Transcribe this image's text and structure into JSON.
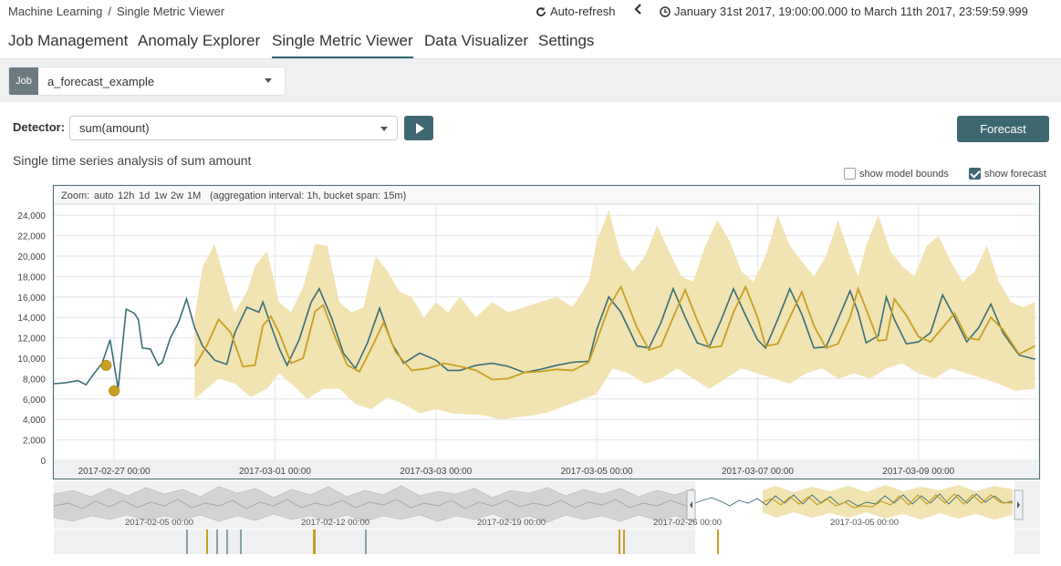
{
  "breadcrumb": {
    "root": "Machine Learning",
    "separator": "/",
    "current": "Single Metric Viewer"
  },
  "header": {
    "auto_refresh": "Auto-refresh",
    "time_range": "January 31st 2017, 19:00:00.000 to March 11th 2017, 23:59:59.999"
  },
  "tabs": [
    {
      "label": "Job Management"
    },
    {
      "label": "Anomaly Explorer"
    },
    {
      "label": "Single Metric Viewer",
      "active": true
    },
    {
      "label": "Data Visualizer"
    },
    {
      "label": "Settings"
    }
  ],
  "job": {
    "badge": "Job",
    "name": "a_forecast_example"
  },
  "detector": {
    "label": "Detector:",
    "value": "sum(amount)"
  },
  "forecast_button": "Forecast",
  "subtitle": "Single time series analysis of sum amount",
  "options": {
    "model_bounds": {
      "label": "show model bounds",
      "checked": false
    },
    "forecast": {
      "label": "show forecast",
      "checked": true
    }
  },
  "zoom": {
    "label": "Zoom:",
    "options": [
      "auto",
      "12h",
      "1d",
      "1w",
      "2w",
      "1M"
    ],
    "info": "(aggregation interval: 1h, bucket span: 15m)"
  },
  "colors": {
    "actual": "#3b6e77",
    "forecast": "#c8a022",
    "bounds": "#f2e3b3",
    "anomaly": "#c8a022",
    "context_grey": "#d4d4d4",
    "tab_underline": "#2d6670",
    "button": "#3e6871"
  },
  "context_ticks": [
    "2017-02-05 00:00",
    "2017-02-12 00:00",
    "2017-02-19 00:00",
    "2017-02-26 00:00",
    "2017-03-05 00:00"
  ],
  "chart_data": {
    "type": "line",
    "title": "",
    "xlabel": "",
    "ylabel": "",
    "ylim": [
      0,
      25000
    ],
    "y_ticks": [
      0,
      2000,
      4000,
      6000,
      8000,
      10000,
      12000,
      14000,
      16000,
      18000,
      20000,
      22000,
      24000
    ],
    "y_tick_labels": [
      "0",
      "2,000",
      "4,000",
      "6,000",
      "8,000",
      "10,000",
      "12,000",
      "14,000",
      "16,000",
      "18,000",
      "20,000",
      "22,000",
      "24,000"
    ],
    "x_tick_labels": [
      "2017-02-27 00:00",
      "2017-03-01 00:00",
      "2017-03-03 00:00",
      "2017-03-05 00:00",
      "2017-03-07 00:00",
      "2017-03-09 00:00"
    ],
    "xlim_days": [
      -0.75,
      11.5
    ],
    "grid": true,
    "series": [
      {
        "kind": "actual",
        "x": [
          -0.75,
          -0.6,
          -0.45,
          -0.35,
          -0.25,
          -0.15,
          -0.05,
          0.05,
          0.15,
          0.25,
          0.3,
          0.35,
          0.45,
          0.55,
          0.6,
          0.7,
          0.8,
          0.9,
          1.0,
          1.1,
          1.25,
          1.4,
          1.5,
          1.65,
          1.8,
          1.85,
          1.95,
          2.05,
          2.15,
          2.3,
          2.45,
          2.55,
          2.7,
          2.85,
          3.0,
          3.15,
          3.3,
          3.45,
          3.6,
          3.8,
          4.0,
          4.15,
          4.3,
          4.5,
          4.7,
          4.9,
          5.1,
          5.3,
          5.5,
          5.7,
          5.9,
          6.0,
          6.15,
          6.3,
          6.5,
          6.65,
          6.8,
          6.95,
          7.1,
          7.25,
          7.4,
          7.55,
          7.7,
          7.85,
          8.0,
          8.1,
          8.25,
          8.4,
          8.55,
          8.7,
          8.85,
          9.0,
          9.15,
          9.25,
          9.35,
          9.5,
          9.6,
          9.7,
          9.85,
          10.0,
          10.15,
          10.3,
          10.45,
          10.6,
          10.75,
          10.9,
          11.05,
          11.25,
          11.45
        ],
        "y": [
          7500,
          7600,
          7800,
          7400,
          8500,
          9500,
          11800,
          7000,
          14800,
          14400,
          13800,
          11000,
          10900,
          9300,
          9600,
          12000,
          13500,
          15800,
          13000,
          11200,
          9800,
          9400,
          12500,
          15000,
          14500,
          15500,
          13200,
          11000,
          9300,
          11800,
          15500,
          16800,
          14000,
          10500,
          9000,
          11500,
          14900,
          11500,
          9500,
          10500,
          9800,
          8800,
          8800,
          9300,
          9500,
          9200,
          8600,
          8900,
          9300,
          9600,
          9700,
          12800,
          16000,
          14500,
          11200,
          11000,
          13500,
          16800,
          14000,
          11500,
          11100,
          13800,
          16800,
          14200,
          11800,
          11000,
          13800,
          16800,
          14300,
          11000,
          11100,
          13800,
          16600,
          14500,
          11500,
          12200,
          16000,
          13800,
          11400,
          11600,
          12500,
          16200,
          14000,
          11600,
          13000,
          15300,
          12500,
          10300,
          9900
        ]
      },
      {
        "kind": "forecast",
        "x": [
          1.0,
          1.15,
          1.3,
          1.45,
          1.6,
          1.75,
          1.85,
          1.95,
          2.05,
          2.2,
          2.35,
          2.5,
          2.6,
          2.75,
          2.9,
          3.05,
          3.2,
          3.35,
          3.5,
          3.7,
          3.9,
          4.1,
          4.3,
          4.5,
          4.7,
          4.9,
          5.1,
          5.3,
          5.5,
          5.7,
          5.9,
          6.0,
          6.15,
          6.3,
          6.5,
          6.65,
          6.8,
          6.95,
          7.1,
          7.25,
          7.4,
          7.55,
          7.7,
          7.85,
          8.0,
          8.1,
          8.25,
          8.4,
          8.55,
          8.7,
          8.85,
          9.0,
          9.15,
          9.25,
          9.35,
          9.5,
          9.6,
          9.7,
          9.85,
          10.0,
          10.15,
          10.3,
          10.45,
          10.6,
          10.75,
          10.9,
          11.05,
          11.25,
          11.45
        ],
        "y": [
          9200,
          11200,
          13800,
          12500,
          9200,
          9300,
          13200,
          14100,
          12500,
          9500,
          10000,
          14600,
          15200,
          12000,
          9300,
          8700,
          11000,
          13500,
          10600,
          8800,
          9000,
          9500,
          9200,
          8800,
          7900,
          8000,
          8600,
          8700,
          8900,
          8800,
          9600,
          11700,
          15000,
          17000,
          13000,
          10800,
          11200,
          14000,
          16700,
          13700,
          11000,
          11200,
          14500,
          17000,
          14000,
          11200,
          11400,
          14000,
          16500,
          13200,
          11000,
          11400,
          14000,
          16800,
          14800,
          11700,
          11800,
          15800,
          14200,
          12100,
          11600,
          13000,
          14400,
          12000,
          11800,
          14000,
          12800,
          10400,
          11200
        ]
      },
      {
        "kind": "bounds_upper",
        "x": [
          1.0,
          1.1,
          1.25,
          1.4,
          1.5,
          1.65,
          1.75,
          1.9,
          2.05,
          2.2,
          2.35,
          2.5,
          2.65,
          2.8,
          2.95,
          3.1,
          3.25,
          3.4,
          3.55,
          3.7,
          3.85,
          4.0,
          4.15,
          4.3,
          4.5,
          4.7,
          4.9,
          5.1,
          5.3,
          5.5,
          5.7,
          5.9,
          6.0,
          6.15,
          6.3,
          6.45,
          6.6,
          6.75,
          6.9,
          7.05,
          7.2,
          7.35,
          7.5,
          7.65,
          7.8,
          7.95,
          8.1,
          8.25,
          8.4,
          8.55,
          8.7,
          8.85,
          9.0,
          9.15,
          9.25,
          9.35,
          9.5,
          9.65,
          9.8,
          9.95,
          10.1,
          10.25,
          10.4,
          10.55,
          10.7,
          10.85,
          11.0,
          11.15,
          11.3,
          11.45
        ],
        "y": [
          14000,
          19000,
          21200,
          17000,
          14500,
          16500,
          19000,
          20500,
          15500,
          14500,
          17000,
          21200,
          21000,
          15500,
          14500,
          15000,
          20000,
          18500,
          16500,
          16000,
          14000,
          15500,
          14500,
          16000,
          14000,
          15500,
          14500,
          15000,
          15500,
          16000,
          15000,
          17500,
          21500,
          24500,
          20000,
          18500,
          20000,
          23000,
          20500,
          18000,
          17500,
          21000,
          23500,
          21500,
          18500,
          17500,
          20000,
          24000,
          21000,
          19500,
          18000,
          20000,
          23500,
          20000,
          18000,
          21000,
          24000,
          20500,
          19000,
          18000,
          21000,
          22000,
          19500,
          17500,
          18500,
          21000,
          17500,
          15500,
          15000,
          15500
        ]
      },
      {
        "kind": "bounds_lower",
        "x": [
          1.0,
          1.15,
          1.3,
          1.5,
          1.7,
          1.9,
          2.05,
          2.2,
          2.4,
          2.6,
          2.8,
          3.0,
          3.2,
          3.4,
          3.6,
          3.8,
          4.0,
          4.2,
          4.4,
          4.6,
          4.8,
          5.0,
          5.2,
          5.4,
          5.6,
          5.8,
          6.0,
          6.2,
          6.4,
          6.6,
          6.8,
          7.0,
          7.2,
          7.4,
          7.6,
          7.8,
          8.0,
          8.2,
          8.4,
          8.6,
          8.8,
          9.0,
          9.2,
          9.4,
          9.6,
          9.8,
          10.0,
          10.2,
          10.4,
          10.6,
          10.8,
          11.0,
          11.2,
          11.45
        ],
        "y": [
          6000,
          7000,
          8000,
          7500,
          6200,
          7000,
          8500,
          7500,
          6000,
          7000,
          7000,
          5500,
          5000,
          6200,
          5500,
          4600,
          5000,
          4600,
          4500,
          4400,
          4000,
          4200,
          4400,
          4700,
          5300,
          5900,
          6500,
          9000,
          8500,
          7500,
          8000,
          9000,
          8000,
          7000,
          8000,
          9000,
          8500,
          8000,
          7500,
          8500,
          9000,
          8000,
          8500,
          8000,
          9000,
          9500,
          8500,
          8000,
          9000,
          8500,
          8000,
          7500,
          6800,
          7000
        ]
      }
    ],
    "anomalies": [
      {
        "x": -0.1,
        "y": 9300
      },
      {
        "x": 0.0,
        "y": 6800
      }
    ]
  }
}
